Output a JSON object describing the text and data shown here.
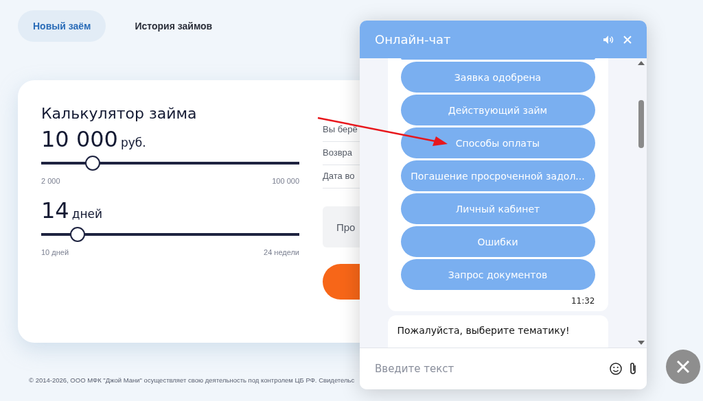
{
  "tabs": [
    {
      "label": "Новый заём",
      "selected": true
    },
    {
      "label": "История займов",
      "selected": false
    }
  ],
  "calculator": {
    "title": "Калькулятор займа",
    "sliders": [
      {
        "value": "10 000",
        "unit": "руб.",
        "level": 0.2,
        "min": "2 000",
        "max": "100 000"
      },
      {
        "value": "14",
        "unit": "дней",
        "level": 0.14,
        "min": "10 дней",
        "max": "24 недели"
      }
    ],
    "summary_rows": [
      "Вы берё",
      "Возвра",
      "Дата во"
    ],
    "promo_field": {
      "placeholder": "Про"
    }
  },
  "footer": "© 2014-2026, ООО МФК \"Джой Мани\" осуществляет свою деятельность под контролем ЦБ РФ. Свидетельс",
  "chat": {
    "title": "Онлайн-чат",
    "options": [
      "Заявка одобрена",
      "Действующий займ",
      "Способы оплаты",
      "Погашение просроченной задол...",
      "Личный кабинет",
      "Ошибки",
      "Запрос документов"
    ],
    "time": "11:32",
    "message": "Пожалуйста, выберите тематику!",
    "input": {
      "placeholder": "Введите текст"
    }
  }
}
